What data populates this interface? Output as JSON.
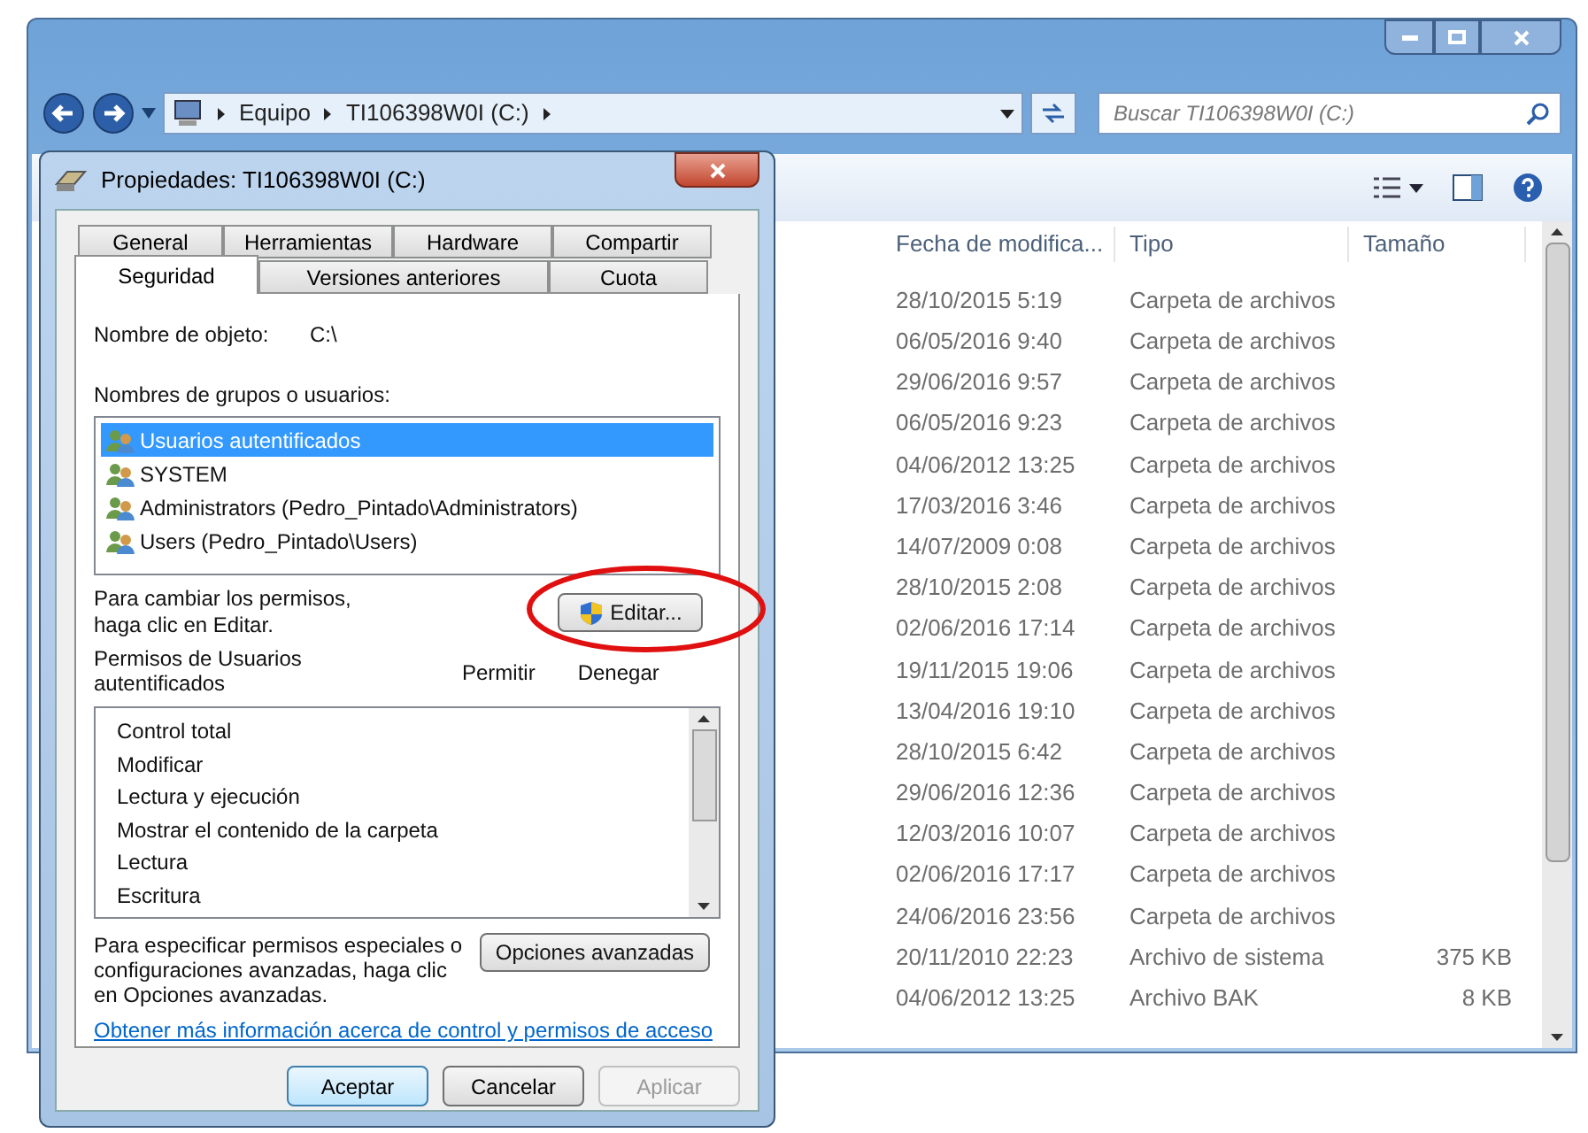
{
  "explorer": {
    "breadcrumb": [
      "Equipo",
      "TI106398W0I (C:)"
    ],
    "search": {
      "placeholder": "Buscar TI106398W0I (C:)"
    },
    "columns": [
      "Fecha de modifica...",
      "Tipo",
      "Tamaño"
    ],
    "rows": [
      {
        "date": "28/10/2015 5:19",
        "type": "Carpeta de archivos"
      },
      {
        "date": "06/05/2016 9:40",
        "type": "Carpeta de archivos"
      },
      {
        "date": "29/06/2016 9:57",
        "type": "Carpeta de archivos"
      },
      {
        "date": "06/05/2016 9:23",
        "type": "Carpeta de archivos"
      },
      {
        "date": "04/06/2012 13:25",
        "type": "Carpeta de archivos"
      },
      {
        "date": "17/03/2016 3:46",
        "type": "Carpeta de archivos"
      },
      {
        "date": "14/07/2009 0:08",
        "type": "Carpeta de archivos"
      },
      {
        "date": "28/10/2015 2:08",
        "type": "Carpeta de archivos"
      },
      {
        "date": "02/06/2016 17:14",
        "type": "Carpeta de archivos"
      },
      {
        "date": "19/11/2015 19:06",
        "type": "Carpeta de archivos"
      },
      {
        "date": "13/04/2016 19:10",
        "type": "Carpeta de archivos"
      },
      {
        "date": "28/10/2015 6:42",
        "type": "Carpeta de archivos"
      },
      {
        "date": "29/06/2016 12:36",
        "type": "Carpeta de archivos"
      },
      {
        "date": "12/03/2016 10:07",
        "type": "Carpeta de archivos"
      },
      {
        "date": "02/06/2016 17:17",
        "type": "Carpeta de archivos"
      },
      {
        "date": "24/06/2016 23:56",
        "type": "Carpeta de archivos"
      },
      {
        "date": "20/11/2010 22:23",
        "type": "Archivo de sistema",
        "size": "375 KB"
      },
      {
        "date": "04/06/2012 13:25",
        "type": "Archivo BAK",
        "size": "8 KB"
      }
    ]
  },
  "dialog": {
    "title": "Propiedades: TI106398W0I (C:)",
    "tab_rows": [
      [
        {
          "label": "General",
          "selected": false
        },
        {
          "label": "Herramientas",
          "selected": false
        },
        {
          "label": "Hardware",
          "selected": false
        },
        {
          "label": "Compartir",
          "selected": false
        }
      ],
      [
        {
          "label": "Seguridad",
          "selected": true
        },
        {
          "label": "Versiones anteriores",
          "selected": false
        },
        {
          "label": "Cuota",
          "selected": false
        }
      ]
    ],
    "object_label": "Nombre de objeto:",
    "object_value": "C:\\",
    "groups_label": "Nombres de grupos o usuarios:",
    "groups": [
      {
        "name": "Usuarios autentificados",
        "selected": true
      },
      {
        "name": "SYSTEM",
        "selected": false
      },
      {
        "name": "Administrators (Pedro_Pintado\\Administrators)",
        "selected": false
      },
      {
        "name": "Users (Pedro_Pintado\\Users)",
        "selected": false
      }
    ],
    "edit_hint": "Para cambiar los permisos, haga clic en Editar.",
    "edit_button": "Editar...",
    "permissions_label": "Permisos de Usuarios autentificados",
    "allow_header": "Permitir",
    "deny_header": "Denegar",
    "permissions": [
      "Control total",
      "Modificar",
      "Lectura y ejecución",
      "Mostrar el contenido de la carpeta",
      "Lectura",
      "Escritura"
    ],
    "advanced_hint": "Para especificar permisos especiales o configuraciones avanzadas, haga clic en Opciones avanzadas.",
    "advanced_button": "Opciones avanzadas",
    "help_link": "Obtener más información acerca de control y permisos de acceso",
    "buttons": [
      {
        "label": "Aceptar",
        "disabled": false
      },
      {
        "label": "Cancelar",
        "disabled": false
      },
      {
        "label": "Aplicar",
        "disabled": true
      }
    ]
  }
}
